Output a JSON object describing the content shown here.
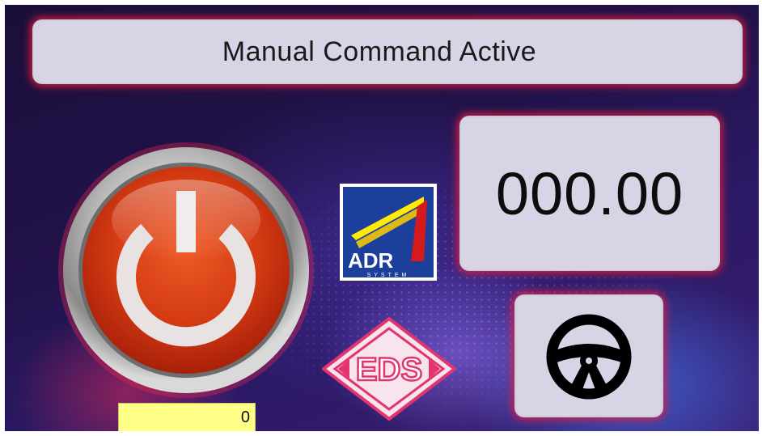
{
  "header": {
    "title": "Manual Command Active"
  },
  "display": {
    "value": "000.00"
  },
  "counter": {
    "value": "0"
  },
  "logos": {
    "adr": {
      "name": "ADR",
      "subtitle": "SYSTEM"
    },
    "eds": {
      "name": "EDS"
    }
  },
  "icons": {
    "power": "power-icon",
    "steering": "steering-wheel-icon"
  },
  "colors": {
    "panel": "#d7d4e6",
    "glow": "#e61e3c",
    "power_red": "#d93a12",
    "counter_bg": "#ffff88"
  }
}
